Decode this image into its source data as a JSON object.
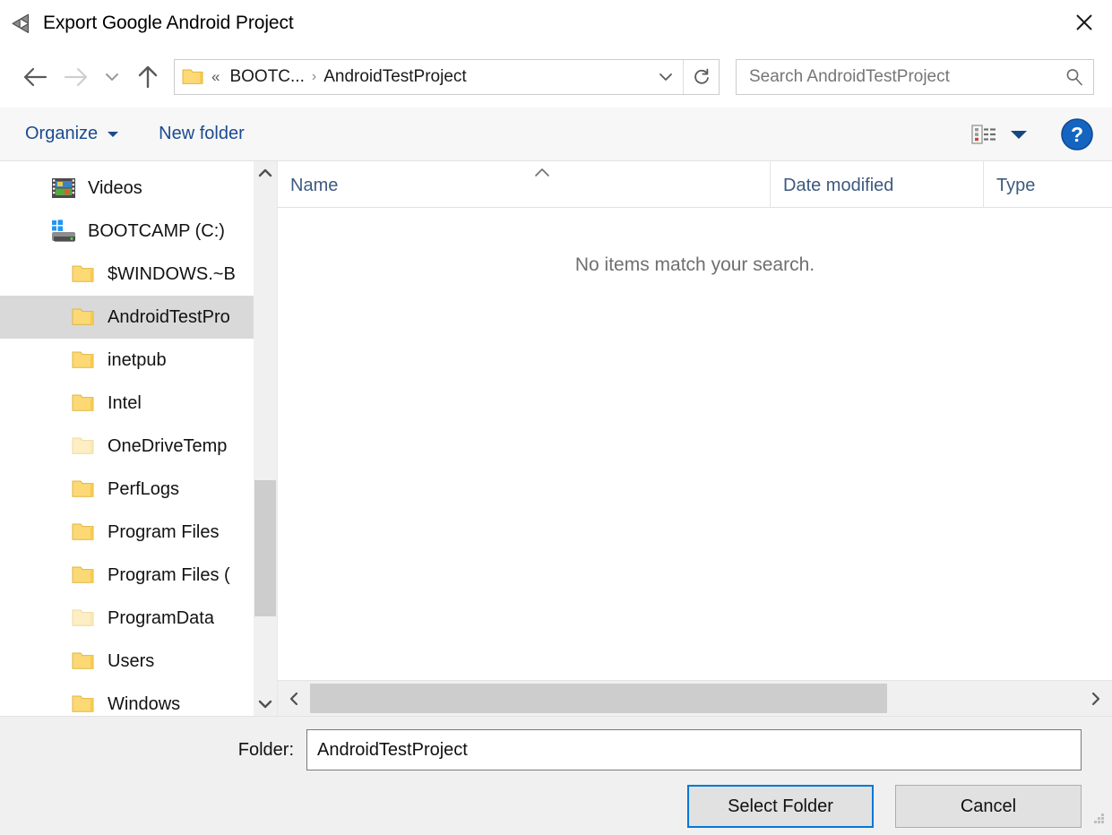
{
  "window": {
    "title": "Export Google Android Project",
    "app_icon": "unity-logo-icon",
    "close_label": "✕"
  },
  "navigation": {
    "back_icon": "back-arrow-icon",
    "forward_icon": "forward-arrow-icon",
    "recent_icon": "recent-locations-chevron-icon",
    "up_icon": "up-arrow-icon",
    "breadcrumb": {
      "folder_icon": "folder-icon",
      "overflow": "«",
      "segments": [
        "BOOTC...",
        "AndroidTestProject"
      ],
      "separator": "›",
      "dropdown_icon": "chevron-down-icon",
      "refresh_icon": "refresh-icon"
    },
    "search": {
      "placeholder": "Search AndroidTestProject",
      "icon": "search-icon"
    }
  },
  "commandbar": {
    "organize_label": "Organize",
    "organize_caret": "▾",
    "new_folder_label": "New folder",
    "view_icon": "list-view-icon",
    "view_caret_icon": "chevron-down-icon",
    "help_label": "?",
    "help_icon": "help-icon"
  },
  "tree": {
    "items": [
      {
        "label": "Videos",
        "icon": "videos-film-icon",
        "indent": false,
        "selected": false,
        "dim": false
      },
      {
        "label": "BOOTCAMP (C:)",
        "icon": "drive-icon",
        "indent": false,
        "selected": false,
        "dim": false
      },
      {
        "label": "$WINDOWS.~B",
        "icon": "folder-icon",
        "indent": true,
        "selected": false,
        "dim": false
      },
      {
        "label": "AndroidTestPro",
        "icon": "folder-icon",
        "indent": true,
        "selected": true,
        "dim": false
      },
      {
        "label": "inetpub",
        "icon": "folder-icon",
        "indent": true,
        "selected": false,
        "dim": false
      },
      {
        "label": "Intel",
        "icon": "folder-icon",
        "indent": true,
        "selected": false,
        "dim": false
      },
      {
        "label": "OneDriveTemp",
        "icon": "folder-icon",
        "indent": true,
        "selected": false,
        "dim": true
      },
      {
        "label": "PerfLogs",
        "icon": "folder-icon",
        "indent": true,
        "selected": false,
        "dim": false
      },
      {
        "label": "Program Files",
        "icon": "folder-icon",
        "indent": true,
        "selected": false,
        "dim": false
      },
      {
        "label": "Program Files (",
        "icon": "folder-icon",
        "indent": true,
        "selected": false,
        "dim": false
      },
      {
        "label": "ProgramData",
        "icon": "folder-icon",
        "indent": true,
        "selected": false,
        "dim": true
      },
      {
        "label": "Users",
        "icon": "folder-icon",
        "indent": true,
        "selected": false,
        "dim": false
      },
      {
        "label": "Windows",
        "icon": "folder-icon",
        "indent": true,
        "selected": false,
        "dim": false
      }
    ],
    "scrollbar": {
      "up_icon": "scroll-up-icon",
      "down_icon": "scroll-down-icon"
    }
  },
  "filelist": {
    "columns": [
      {
        "label": "Name",
        "sorted": true,
        "sort_caret": "˄"
      },
      {
        "label": "Date modified",
        "sorted": false
      },
      {
        "label": "Type",
        "sorted": false
      }
    ],
    "empty_message": "No items match your search.",
    "rows": [],
    "hscrollbar": {
      "left_icon": "scroll-left-icon",
      "right_icon": "scroll-right-icon"
    }
  },
  "footer": {
    "folder_label": "Folder:",
    "folder_value": "AndroidTestProject",
    "select_button": "Select Folder",
    "cancel_button": "Cancel",
    "resize_grip": "resize-grip-icon"
  },
  "colors": {
    "accent": "#0078d7",
    "link": "#1b4b8f",
    "selection": "#d9d9d9",
    "folder_yellow": "#fcd975",
    "chrome": "#f0f0f0"
  }
}
